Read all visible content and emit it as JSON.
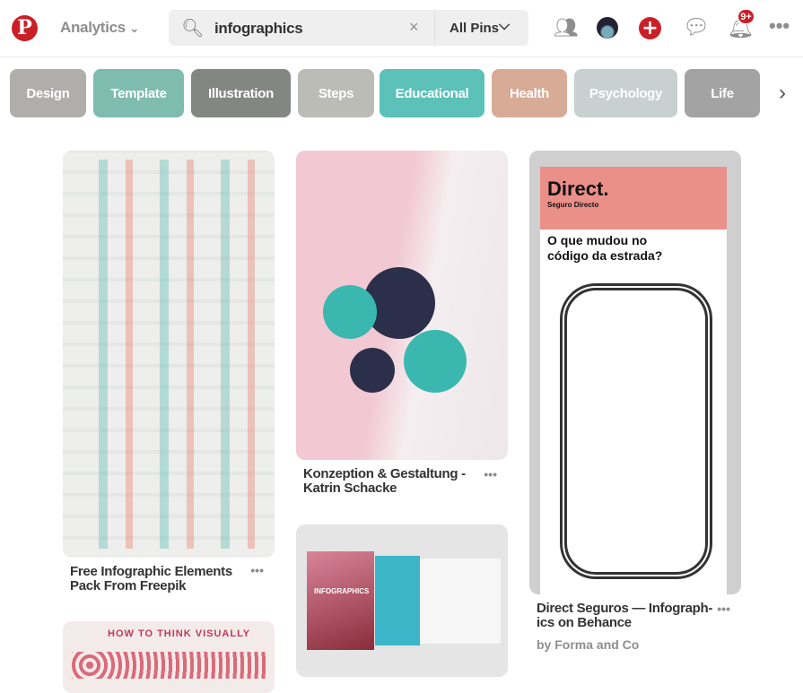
{
  "header": {
    "analytics_label": "Analytics",
    "search_query": "infographics",
    "clear_icon": "×",
    "filter_label": "All Pins",
    "notification_count": "9+"
  },
  "chips": [
    {
      "label": "Design",
      "color": "#b0aeab"
    },
    {
      "label": "Template",
      "color": "#7fbcb0"
    },
    {
      "label": "Illustration",
      "color": "#838782"
    },
    {
      "label": "Steps",
      "color": "#bcbcb7"
    },
    {
      "label": "Educational",
      "color": "#5bc1b9"
    },
    {
      "label": "Health",
      "color": "#d7ab96"
    },
    {
      "label": "Psychology",
      "color": "#c8d0d0"
    },
    {
      "label": "Life",
      "color": "#a3a3a3"
    }
  ],
  "pins": [
    {
      "title": "Free Infographic Elements Pack From Freepik"
    },
    {
      "title": "Konzeption & Gestaltung - Katrin Schacke"
    },
    {
      "title": "Direct Seguros — Infograph-ics on Behance",
      "author": "by Forma and Co",
      "image_heading": "Direct.",
      "image_sub": "Seguro Directo",
      "image_question": "O que mudou no código da estrada?"
    },
    {
      "image_heading": "HOW TO THINK VISUALLY"
    },
    {
      "image_heading": "INFOGRAPHICS"
    }
  ]
}
